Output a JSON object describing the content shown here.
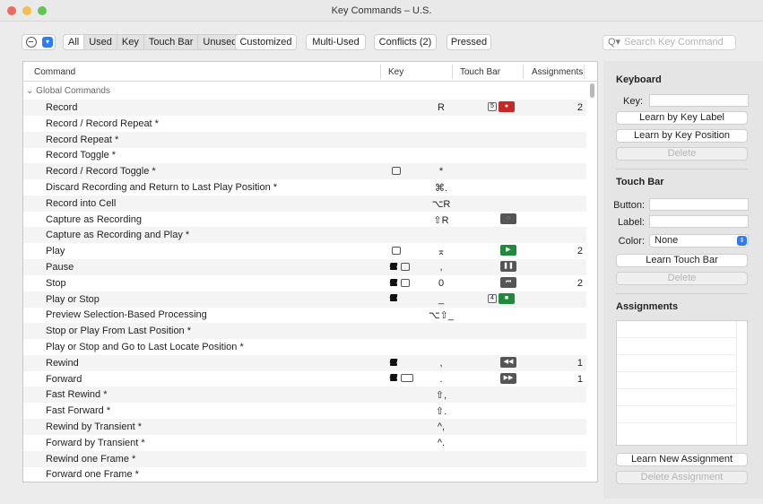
{
  "window": {
    "title": "Key Commands – U.S."
  },
  "toolbar": {
    "filter_tabs": [
      "All",
      "Used",
      "Key",
      "Touch Bar",
      "Unused"
    ],
    "customized": "Customized",
    "multi_used": "Multi-Used",
    "conflicts": "Conflicts (2)",
    "pressed": "Pressed",
    "search_placeholder": "Search Key Command"
  },
  "table": {
    "headers": {
      "command": "Command",
      "key": "Key",
      "touch_bar": "Touch Bar",
      "assignments": "Assignments"
    },
    "group": "Global Commands",
    "rows": [
      {
        "command": "Record",
        "modifier": "",
        "key": "R",
        "touch_bar": "record",
        "tb_num": "5",
        "assignments": "2"
      },
      {
        "command": "Record / Record Repeat *",
        "modifier": "",
        "key": "",
        "touch_bar": "",
        "tb_num": "",
        "assignments": ""
      },
      {
        "command": "Record Repeat *",
        "modifier": "",
        "key": "",
        "touch_bar": "",
        "tb_num": "",
        "assignments": ""
      },
      {
        "command": "Record Toggle *",
        "modifier": "",
        "key": "",
        "touch_bar": "",
        "tb_num": "",
        "assignments": ""
      },
      {
        "command": "Record / Record Toggle *",
        "modifier": "keypad",
        "key": "*",
        "touch_bar": "",
        "tb_num": "",
        "assignments": ""
      },
      {
        "command": "Discard Recording and Return to Last Play Position *",
        "modifier": "",
        "key": "⌘.",
        "touch_bar": "",
        "tb_num": "",
        "assignments": ""
      },
      {
        "command": "Record into Cell",
        "modifier": "",
        "key": "⌥R",
        "touch_bar": "",
        "tb_num": "",
        "assignments": ""
      },
      {
        "command": "Capture as Recording",
        "modifier": "",
        "key": "⇧R",
        "touch_bar": "capture",
        "tb_num": "",
        "assignments": ""
      },
      {
        "command": "Capture as Recording and Play *",
        "modifier": "",
        "key": "",
        "touch_bar": "",
        "tb_num": "",
        "assignments": ""
      },
      {
        "command": "Play",
        "modifier": "keypad",
        "key": "⌅",
        "touch_bar": "play",
        "tb_num": "",
        "assignments": "2"
      },
      {
        "command": "Pause",
        "modifier": "layers-keypad",
        "key": ",",
        "touch_bar": "pause",
        "tb_num": "",
        "assignments": ""
      },
      {
        "command": "Stop",
        "modifier": "layers-keypad",
        "key": "0",
        "touch_bar": "stop",
        "tb_num": "",
        "assignments": "2"
      },
      {
        "command": "Play or Stop",
        "modifier": "layers",
        "key": "_",
        "touch_bar": "playstop",
        "tb_num": "4",
        "assignments": ""
      },
      {
        "command": "Preview Selection-Based Processing",
        "modifier": "",
        "key": "⌥⇧_",
        "touch_bar": "",
        "tb_num": "",
        "assignments": ""
      },
      {
        "command": "Stop or Play From Last Position *",
        "modifier": "",
        "key": "",
        "touch_bar": "",
        "tb_num": "",
        "assignments": ""
      },
      {
        "command": "Play or Stop and Go to Last Locate Position *",
        "modifier": "",
        "key": "",
        "touch_bar": "",
        "tb_num": "",
        "assignments": ""
      },
      {
        "command": "Rewind",
        "modifier": "layers",
        "key": ",",
        "touch_bar": "rewind",
        "tb_num": "",
        "assignments": "1"
      },
      {
        "command": "Forward",
        "modifier": "layers-keyboard",
        "key": ".",
        "touch_bar": "forward",
        "tb_num": "",
        "assignments": "1"
      },
      {
        "command": "Fast Rewind *",
        "modifier": "",
        "key": "⇧,",
        "touch_bar": "",
        "tb_num": "",
        "assignments": ""
      },
      {
        "command": "Fast Forward *",
        "modifier": "",
        "key": "⇧.",
        "touch_bar": "",
        "tb_num": "",
        "assignments": ""
      },
      {
        "command": "Rewind by Transient *",
        "modifier": "",
        "key": "^,",
        "touch_bar": "",
        "tb_num": "",
        "assignments": ""
      },
      {
        "command": "Forward by Transient *",
        "modifier": "",
        "key": "^.",
        "touch_bar": "",
        "tb_num": "",
        "assignments": ""
      },
      {
        "command": "Rewind one Frame *",
        "modifier": "",
        "key": "",
        "touch_bar": "",
        "tb_num": "",
        "assignments": ""
      },
      {
        "command": "Forward one Frame *",
        "modifier": "",
        "key": "",
        "touch_bar": "",
        "tb_num": "",
        "assignments": ""
      }
    ]
  },
  "panel": {
    "keyboard": {
      "heading": "Keyboard",
      "key_label": "Key:",
      "learn_label": "Learn by Key Label",
      "learn_position": "Learn by Key Position",
      "delete": "Delete"
    },
    "touch_bar": {
      "heading": "Touch Bar",
      "button_label": "Button:",
      "label_label": "Label:",
      "color_label": "Color:",
      "color_value": "None",
      "learn": "Learn Touch Bar",
      "delete": "Delete"
    },
    "assignments": {
      "heading": "Assignments",
      "learn_new": "Learn New Assignment",
      "delete": "Delete Assignment"
    }
  },
  "colors": {
    "accent": "#2c7cf6",
    "record": "#c62828",
    "play": "#1f8a3a",
    "tb_gray": "#555555"
  }
}
